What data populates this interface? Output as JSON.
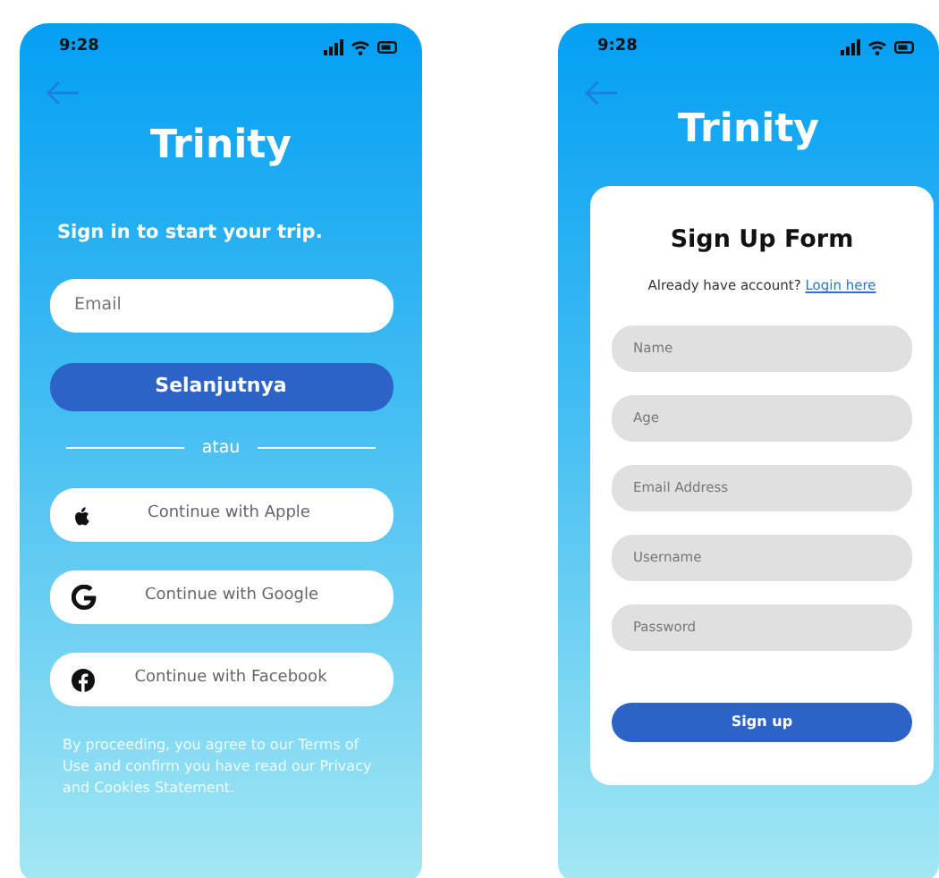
{
  "screens": [
    {
      "status_bar": {
        "time": "9:28"
      },
      "brand": "Trinity",
      "tagline": "Sign in to start your trip.",
      "email_field": {
        "placeholder": "Email"
      },
      "next_button": "Selanjutnya",
      "divider": "atau",
      "social_buttons": [
        {
          "kind": "apple",
          "label": "Continue with Apple"
        },
        {
          "kind": "google",
          "label": "Continue with Google"
        },
        {
          "kind": "facebook",
          "label": "Continue with Facebook"
        }
      ],
      "terms": "By proceeding, you agree to our Terms of Use and confirm you have read our Privacy and Cookies Statement."
    },
    {
      "status_bar": {
        "time": "9:28"
      },
      "brand": "Trinity",
      "form": {
        "title": "Sign Up Form",
        "prompt": "Already have account?",
        "login_link": "Login here",
        "fields": [
          {
            "placeholder": "Name"
          },
          {
            "placeholder": "Age"
          },
          {
            "placeholder": "Email Address"
          },
          {
            "placeholder": "Username"
          },
          {
            "placeholder": "Password"
          }
        ],
        "submit": "Sign up"
      }
    }
  ]
}
